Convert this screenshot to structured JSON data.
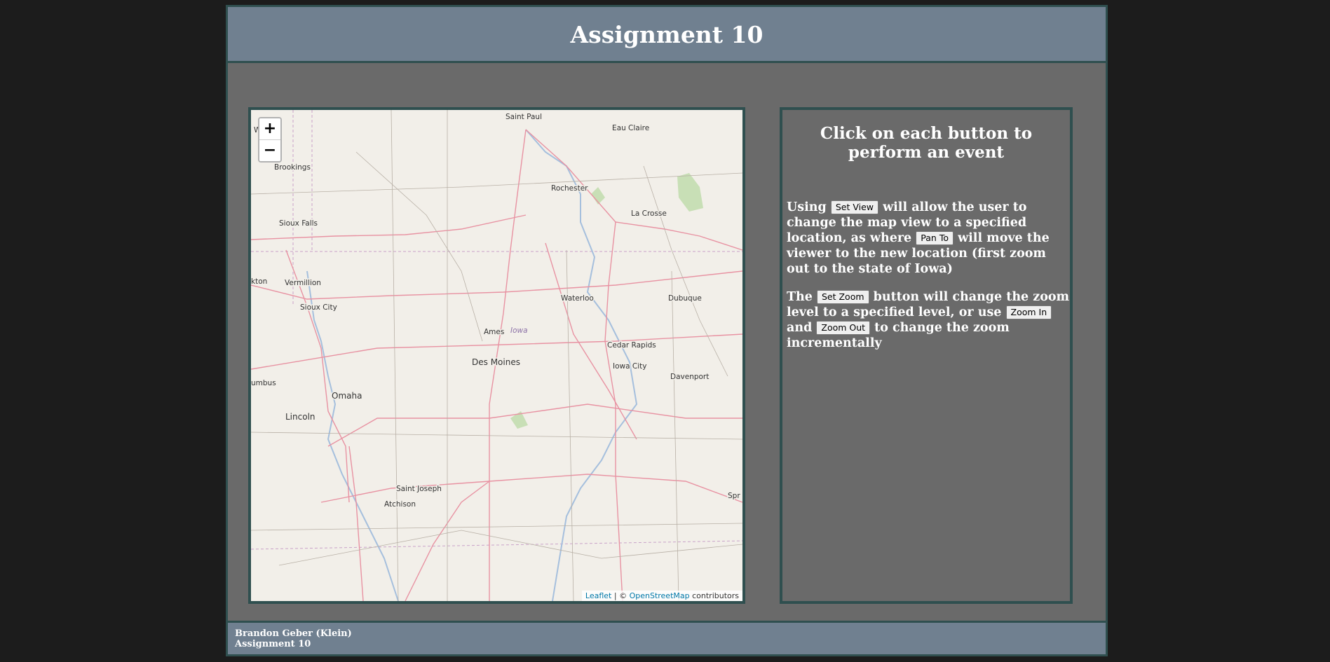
{
  "header": {
    "title": "Assignment 10"
  },
  "map": {
    "zoom_in_label": "+",
    "zoom_out_label": "−",
    "attribution": {
      "leaflet": "Leaflet",
      "separator": " | © ",
      "osm": "OpenStreetMap",
      "suffix": " contributors"
    },
    "region_label": "Iowa",
    "cities": [
      "Saint Paul",
      "Eau Claire",
      "Brookings",
      "Rochester",
      "La Crosse",
      "Sioux Falls",
      "Vermillion",
      "Sioux City",
      "Waterloo",
      "Dubuque",
      "Ames",
      "Cedar Rapids",
      "Des Moines",
      "Iowa City",
      "Davenport",
      "Omaha",
      "Lincoln",
      "Saint Joseph",
      "Atchison",
      "umbus",
      "kton",
      "Wa",
      "Spr"
    ]
  },
  "panel": {
    "heading": "Click on each button to perform an event",
    "p1": {
      "t1": "Using",
      "set_view": "Set View",
      "t2": "will allow the user to change the map view to a specified location, as where",
      "pan_to": "Pan To",
      "t3": "will move the viewer to the new location (first zoom out to the state of Iowa)"
    },
    "p2": {
      "t1": "The",
      "set_zoom": "Set Zoom",
      "t2": "button will change the zoom level to a specified level, or use",
      "zoom_in": "Zoom In",
      "t3": "and",
      "zoom_out": "Zoom Out",
      "t4": "to change the zoom incrementally"
    }
  },
  "footer": {
    "line1": "Brandon Geber (Klein)",
    "line2": "Assignment 10"
  }
}
